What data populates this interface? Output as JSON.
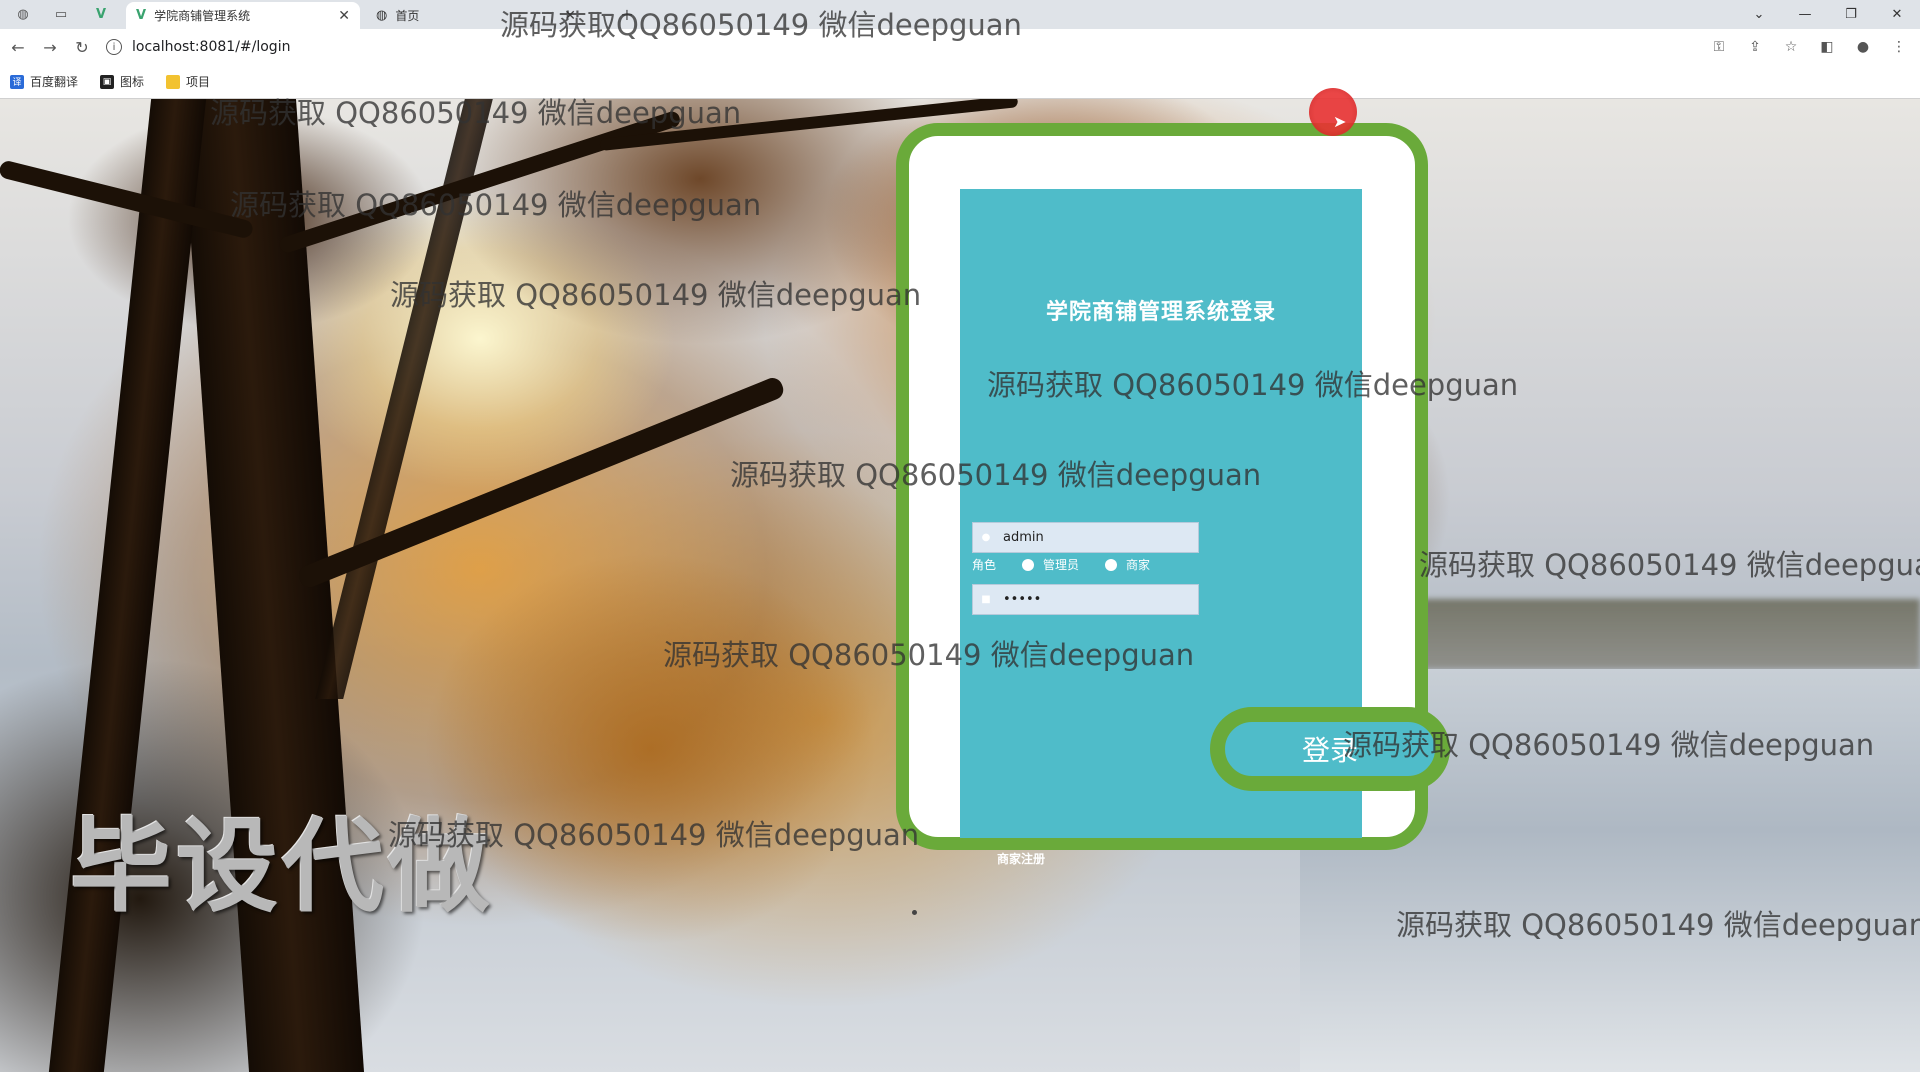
{
  "browser": {
    "tabs": [
      {
        "title": "学院商铺管理系统",
        "active": true,
        "favicon": "vue-logo-icon"
      },
      {
        "title": "首页",
        "active": false,
        "favicon": "globe-icon"
      }
    ],
    "url": "localhost:8081/#/login",
    "bookmarks": [
      {
        "label": "百度翻译",
        "icon": "translate-icon",
        "color": "#2a6bd8"
      },
      {
        "label": "图标",
        "icon": "image-icon",
        "color": "#222222"
      },
      {
        "label": "项目",
        "icon": "folder-icon",
        "color": "#f2c230"
      }
    ]
  },
  "login": {
    "title": "学院商铺管理系统登录",
    "username_value": "admin",
    "password_value": "•••••",
    "role_label": "角色",
    "roles": [
      "管理员",
      "商家"
    ],
    "submit_label": "登录",
    "register_label": "商家注册"
  },
  "overlay": {
    "big_text": "毕设代做",
    "watermark": "源码获取 QQ86050149 微信deepguan",
    "watermark_top": "源码获取QQ86050149 微信deepguan"
  },
  "colors": {
    "accent_green": "#6aaa3a",
    "panel_teal": "#4fbcc9"
  }
}
